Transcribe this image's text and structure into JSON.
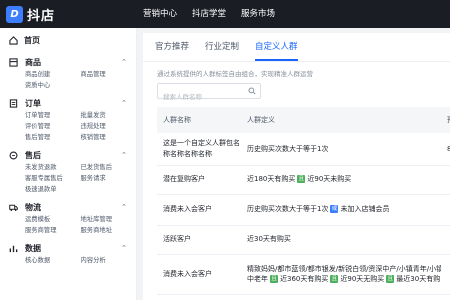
{
  "app": {
    "logo_letter": "D",
    "name": "抖店"
  },
  "topnav": [
    "营销中心",
    "抖店学堂",
    "服务市场"
  ],
  "sidebar": {
    "home": "首页",
    "sections": [
      {
        "title": "商品",
        "items": [
          "商品创建",
          "商品管理",
          "资质中心"
        ]
      },
      {
        "title": "订单",
        "items": [
          "订单管理",
          "批量发货",
          "评价管理",
          "违规处理",
          "售后管理",
          "核销管理"
        ]
      },
      {
        "title": "售后",
        "items": [
          "未发货退款",
          "已发货售后",
          "客服专属售后",
          "服务请求",
          "极速退款单"
        ]
      },
      {
        "title": "物流",
        "items": [
          "运费模板",
          "地址库管理",
          "服务商管理",
          "服务商地址"
        ]
      },
      {
        "title": "数据",
        "items": [
          "核心数据",
          "内容分析"
        ]
      }
    ]
  },
  "tabs": [
    "官方推荐",
    "行业定制",
    "自定义人群"
  ],
  "active_tab": 2,
  "description": "通过系统提供的人群标签自由组合，实现精准人群运营",
  "search": {
    "placeholder": "搜索人群名称"
  },
  "table": {
    "headers": [
      "人群名称",
      "人群定义",
      "预"
    ],
    "rows": [
      {
        "name": "这是一个自定义人群包名称名称名称名称",
        "def": "历史购买次数大于等于1次",
        "extra": "88"
      },
      {
        "name": "潜在复购客户",
        "def_parts": [
          "近180天有购买",
          "近90天未购买"
        ],
        "tag": "且",
        "extra": ""
      },
      {
        "name": "消费未入会客户",
        "def_parts": [
          "历史购买次数大于等于1次",
          "未加入店铺会员"
        ],
        "tag": "或",
        "extra": ""
      },
      {
        "name": "活跃客户",
        "def": "近30天有购买",
        "extra": ""
      },
      {
        "name": "消费未入会客户",
        "def_lines": [
          "精致妈妈/都市蓝领/都市银发/新锐白领/资深中产/小镇青年/小镇",
          "中老年",
          "近360天有购买",
          "近90天无购买",
          "最近30天有购"
        ],
        "tags": [
          "且",
          "且",
          "且"
        ],
        "extra": ""
      }
    ]
  },
  "colors": {
    "accent": "#1966ff",
    "topbar": "#1a1d24",
    "tag_and": "#4cb05c",
    "tag_or": "#3d7eff"
  }
}
